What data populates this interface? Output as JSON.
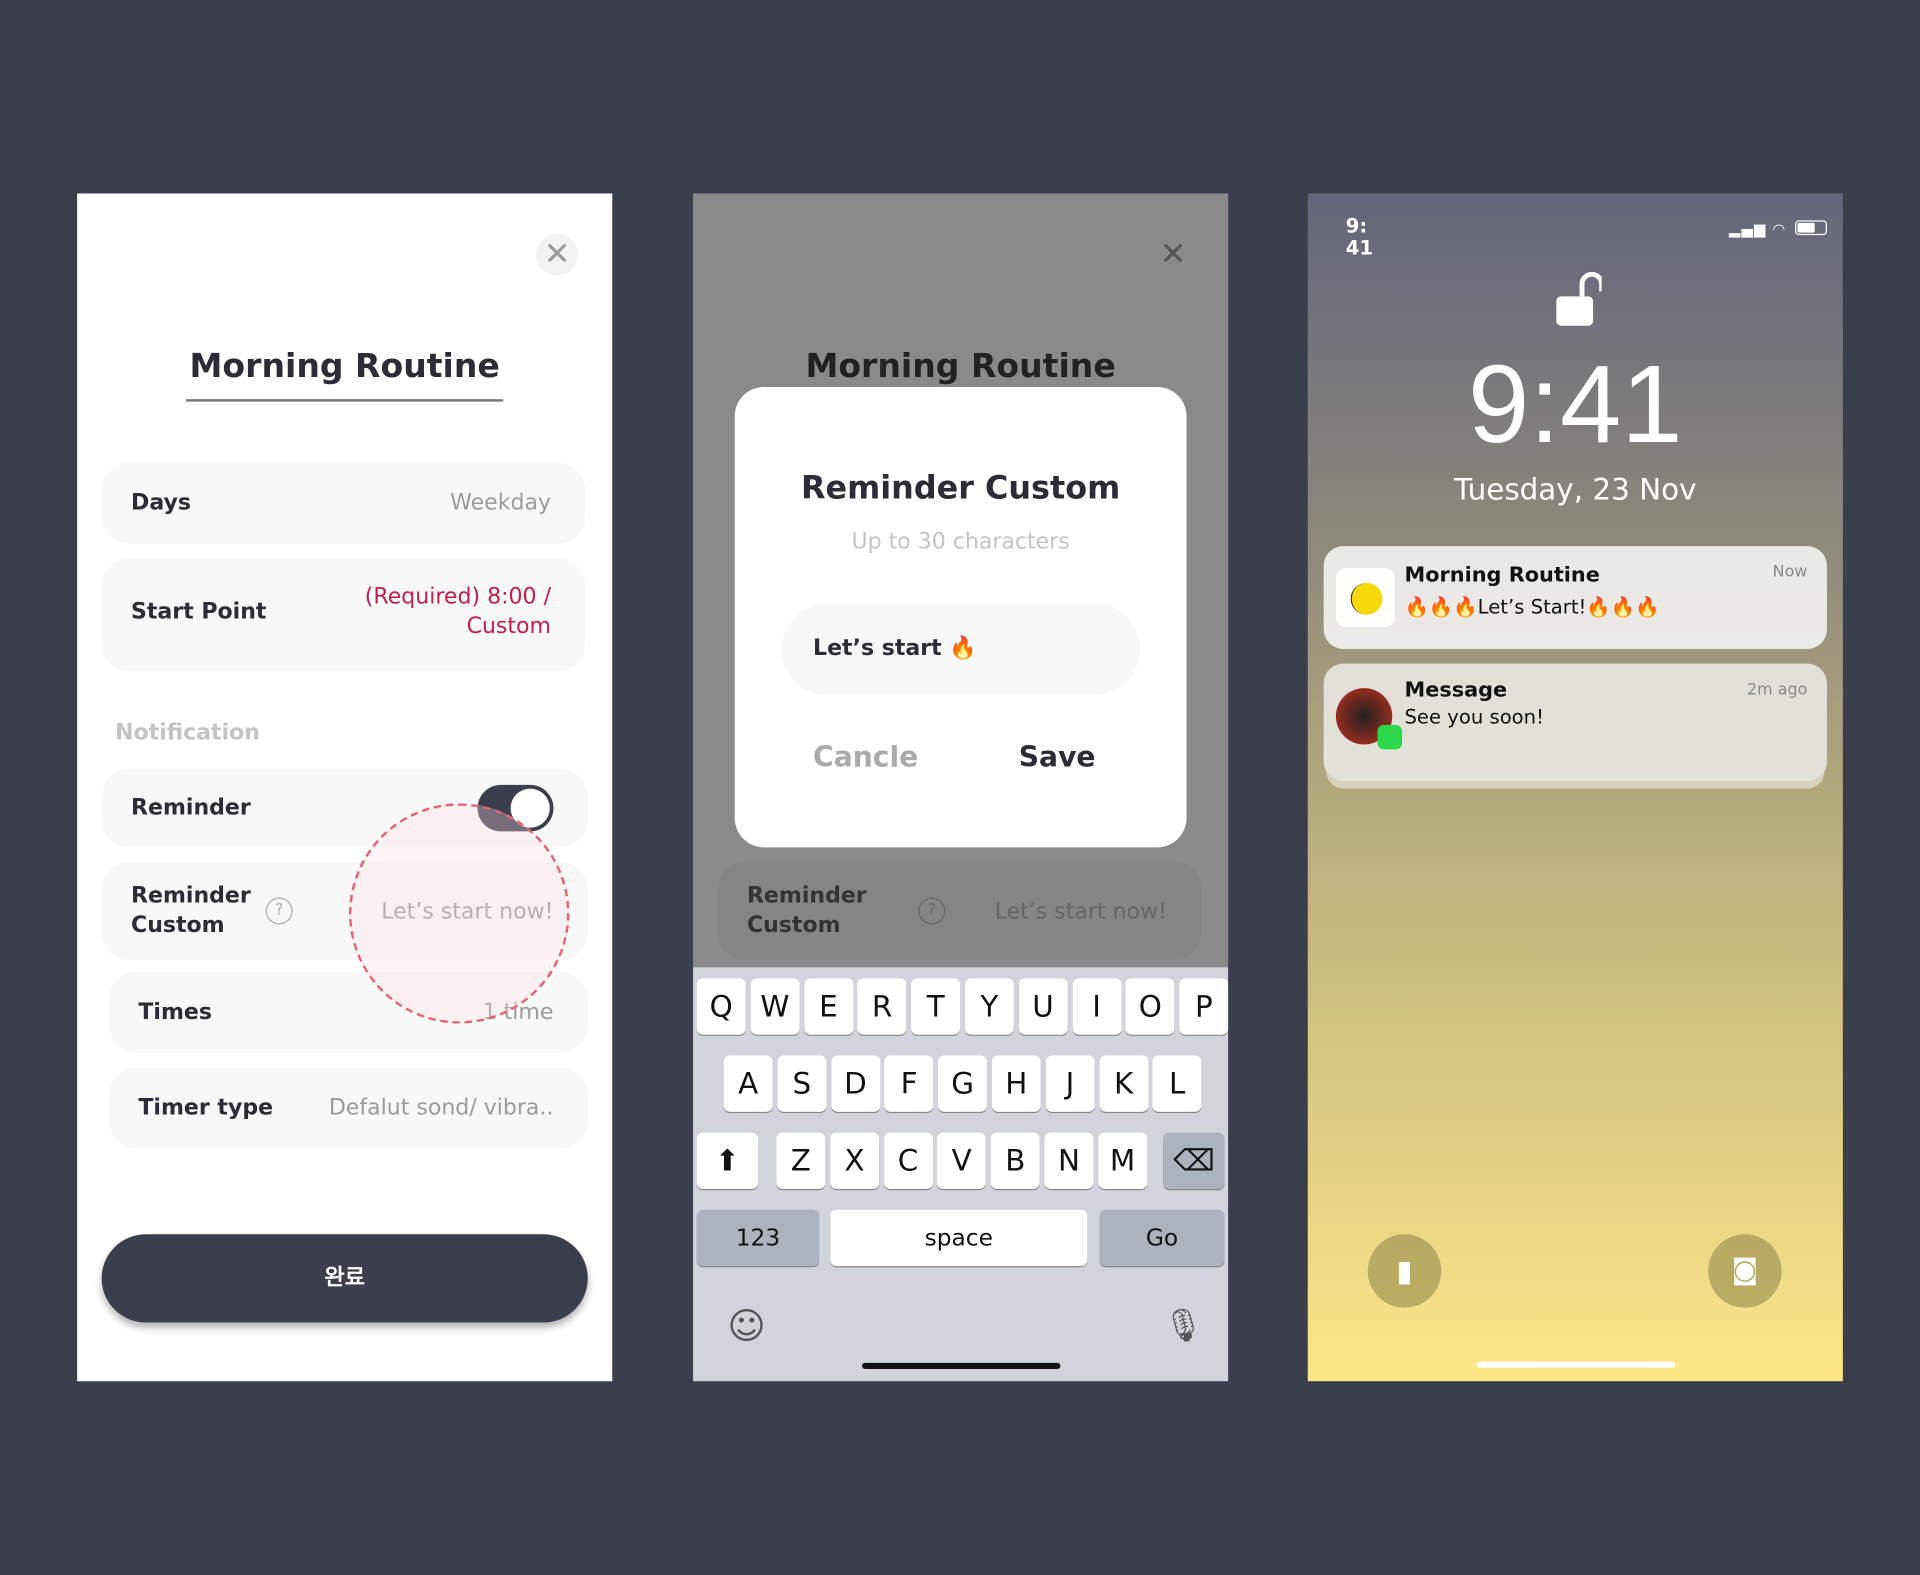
{
  "screen1": {
    "title": "Morning Routine",
    "rows": [
      {
        "label": "Days",
        "value": "Weekday"
      },
      {
        "label": "Start Point",
        "value_line1": "(Required) 8:00 /",
        "value_line2": "Custom"
      }
    ],
    "section": "Notification",
    "reminder": {
      "label": "Reminder",
      "toggle_on": true
    },
    "reminder_custom": {
      "label_line1": "Reminder",
      "label_line2": "Custom",
      "value": "Let’s start now!"
    },
    "times": {
      "label": "Times",
      "value": "1 time"
    },
    "timer_type": {
      "label": "Timer type",
      "value": "Defalut sond/ vibra.."
    },
    "done_button": "완료",
    "accent": "#c0214a"
  },
  "screen2": {
    "bg_title": "Morning Routine",
    "dialog": {
      "title": "Reminder Custom",
      "hint": "Up to 30 characters",
      "input_value": "Let’s start 🔥",
      "cancel": "Cancle",
      "save": "Save"
    },
    "bg_row": {
      "label_line1": "Reminder",
      "label_line2": "Custom",
      "value": "Let’s start now!"
    },
    "keyboard": {
      "row1": [
        "Q",
        "W",
        "E",
        "R",
        "T",
        "Y",
        "U",
        "I",
        "O",
        "P"
      ],
      "row2": [
        "A",
        "S",
        "D",
        "F",
        "G",
        "H",
        "J",
        "K",
        "L"
      ],
      "row3": [
        "Z",
        "X",
        "C",
        "V",
        "B",
        "N",
        "M"
      ],
      "numbers": "123",
      "space": "space",
      "go": "Go"
    }
  },
  "screen3": {
    "status_time": "9:41",
    "clock": "9:41",
    "date": "Tuesday,  23 Nov",
    "notifications": [
      {
        "app": "Morning Routine",
        "body": "🔥🔥🔥Let’s Start!🔥🔥🔥",
        "time": "Now"
      },
      {
        "app": "Message",
        "body": "See you soon!",
        "time": "2m ago"
      }
    ]
  }
}
